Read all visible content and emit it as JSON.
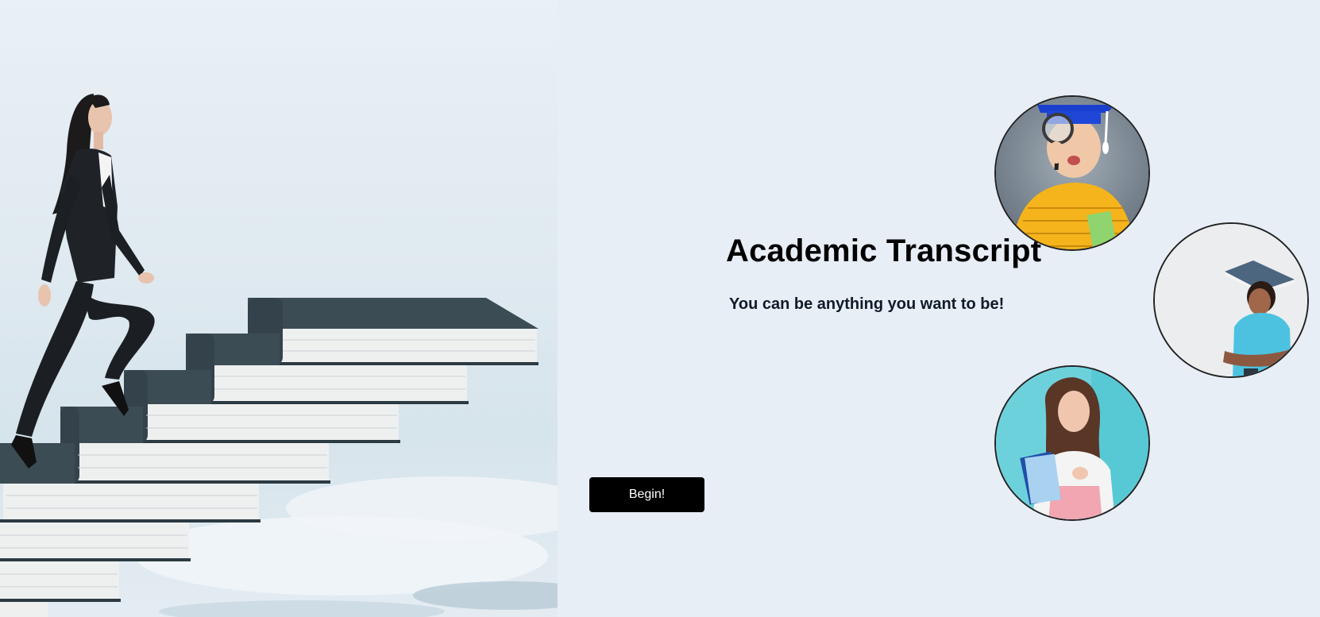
{
  "hero": {
    "image": "woman-climbing-book-stairs"
  },
  "main": {
    "title": "Academic Transcript",
    "subtitle": "You can be anything you want to be!",
    "begin_label": "Begin!"
  },
  "avatars": [
    {
      "image": "boy-with-graduation-cap-and-magnifier"
    },
    {
      "image": "girl-with-book-on-head"
    },
    {
      "image": "young-woman-holding-notebooks"
    }
  ],
  "colors": {
    "page_background": "#e8eef5",
    "button_background": "#000000",
    "button_text": "#ffffff",
    "title_text": "#000000",
    "subtitle_text": "#0f1b2a"
  }
}
